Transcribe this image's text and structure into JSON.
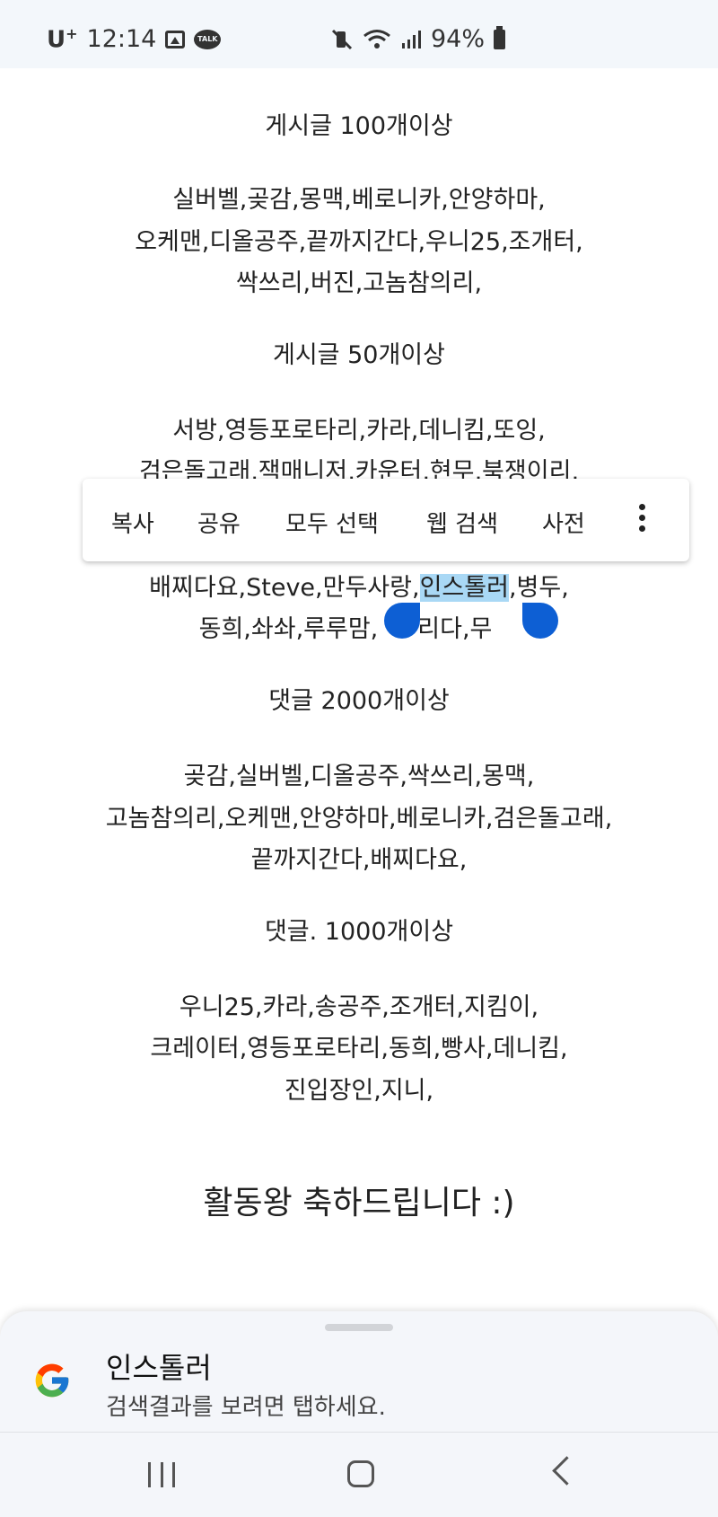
{
  "statusbar": {
    "carrier": "U",
    "carrier_plus": "+",
    "time": "12:14",
    "talk_badge": "TALK",
    "battery": "94%",
    "icons": [
      "image-icon",
      "kakaotalk-icon",
      "mute-vibrate-icon",
      "wifi-icon",
      "signal-icon",
      "battery-icon"
    ]
  },
  "content": {
    "sections": [
      {
        "heading": "게시글 100개이상",
        "lines": [
          "실버벨,곶감,몽맥,베로니카,안양하마,",
          "오케맨,디올공주,끝까지간다,우니25,조개터,",
          "싹쓰리,버진,고놈참의리,"
        ]
      },
      {
        "heading": "게시글 50개이상",
        "lines": [
          "서방,영등포로타리,카라,데니킴,또잉,",
          "검은돌고래,잭매니저,카운터,현무,북쟁이리,",
          "배찌다요,Steve,만두사랑,",
          "동희,솨솨,루루맘,",
          "리다,무",
          "인스톨러",
          ",병두,"
        ]
      },
      {
        "heading": "댓글 2000개이상",
        "lines": [
          "곶감,실버벨,디올공주,싹쓰리,몽맥,",
          "고놈참의리,오케맨,안양하마,베로니카,검은돌고래,",
          "끝까지간다,배찌다요,"
        ]
      },
      {
        "heading": "댓글. 1000개이상",
        "lines": [
          "우니25,카라,송공주,조개터,지킴이,",
          "크레이터,영등포로타리,동희,빵사,데니킴,",
          "진입장인,지니,"
        ]
      }
    ],
    "celebrate": "활동왕 축하드립니다 :)"
  },
  "context_menu": {
    "copy": "복사",
    "share": "공유",
    "select_all": "모두 선택",
    "web_search": "웹 검색",
    "dictionary": "사전"
  },
  "sheet": {
    "title": "인스톨러",
    "subtitle": "검색결과를 보려면 탭하세요."
  },
  "colors": {
    "selection_highlight": "#a9d8f5",
    "handle": "#0d5fd4",
    "statusbar_bg": "#f3f7fb",
    "sheet_bg": "#f4f6fa"
  }
}
